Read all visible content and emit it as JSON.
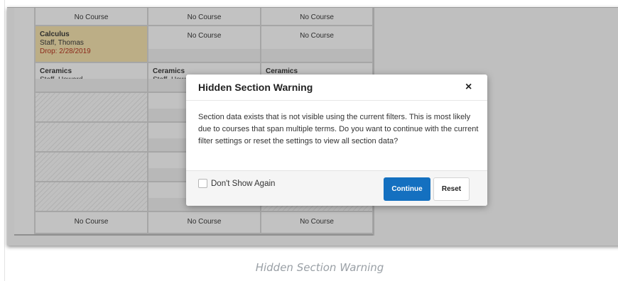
{
  "schedule": {
    "no_course": "No Course",
    "calculus": {
      "name": "Calculus",
      "teacher": "Staff, Thomas",
      "drop": "Drop: 2/28/2019"
    },
    "ceramics_1": {
      "name": "Ceramics",
      "teacher": "Staff, Howard"
    },
    "ceramics_2": {
      "name": "Ceramics",
      "teacher": "Staff, Howard"
    },
    "ceramics_3": {
      "name": "Ceramics"
    },
    "partial_label": "N"
  },
  "modal": {
    "title": "Hidden Section Warning",
    "close_glyph": "×",
    "body": "Section data exists that is not visible using the current filters. This is most likely due to courses that span multiple terms. Do you want to continue with the current filter settings or reset the settings to view all section data?",
    "dont_show_label": "Don't Show Again",
    "continue_label": "Continue",
    "reset_label": "Reset"
  },
  "caption": "Hidden Section Warning",
  "colors": {
    "primary_button": "#1470c0",
    "drop_text": "#8c2a1a",
    "caption_text": "#9aa0a6"
  }
}
